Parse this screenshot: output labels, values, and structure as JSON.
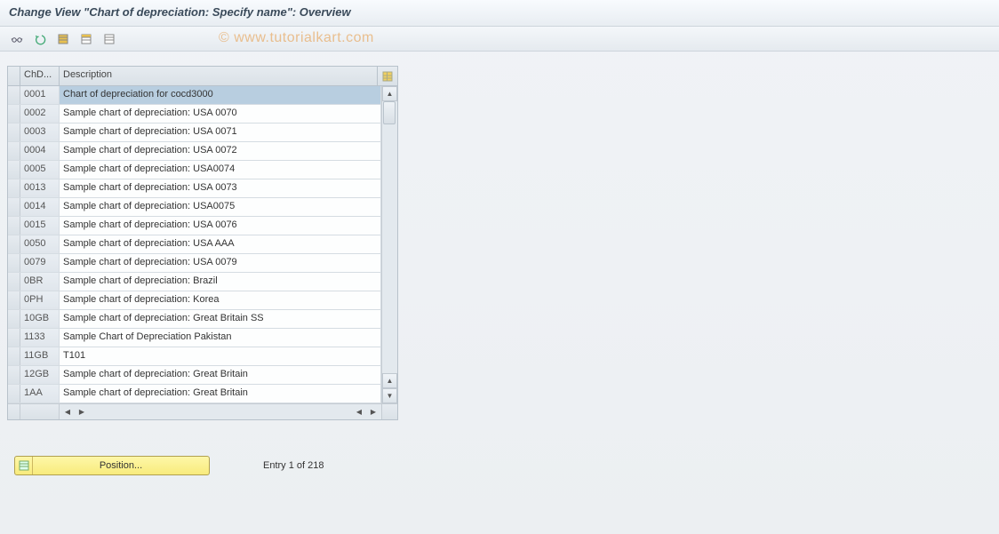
{
  "title": "Change View \"Chart of depreciation: Specify name\": Overview",
  "watermark": "© www.tutorialkart.com",
  "columns": {
    "chd": "ChD...",
    "desc": "Description"
  },
  "rows": [
    {
      "chd": "0001",
      "desc": "Chart of depreciation for cocd3000",
      "selected": true
    },
    {
      "chd": "0002",
      "desc": "Sample chart of depreciation: USA 0070"
    },
    {
      "chd": "0003",
      "desc": "Sample chart of depreciation: USA 0071"
    },
    {
      "chd": "0004",
      "desc": "Sample chart of depreciation: USA 0072"
    },
    {
      "chd": "0005",
      "desc": "Sample chart of depreciation: USA0074"
    },
    {
      "chd": "0013",
      "desc": "Sample chart of depreciation: USA 0073"
    },
    {
      "chd": "0014",
      "desc": "Sample chart of depreciation: USA0075"
    },
    {
      "chd": "0015",
      "desc": "Sample chart of depreciation: USA 0076"
    },
    {
      "chd": "0050",
      "desc": "Sample chart of depreciation: USA AAA"
    },
    {
      "chd": "0079",
      "desc": "Sample chart of depreciation: USA 0079"
    },
    {
      "chd": "0BR",
      "desc": "Sample chart of depreciation: Brazil"
    },
    {
      "chd": "0PH",
      "desc": "Sample chart of depreciation: Korea"
    },
    {
      "chd": "10GB",
      "desc": "Sample chart of depreciation: Great Britain SS"
    },
    {
      "chd": "1133",
      "desc": "Sample Chart of Depreciation Pakistan"
    },
    {
      "chd": "11GB",
      "desc": "T101"
    },
    {
      "chd": "12GB",
      "desc": "Sample chart of depreciation: Great Britain"
    },
    {
      "chd": "1AA",
      "desc": "Sample chart of depreciation: Great Britain"
    }
  ],
  "footer": {
    "position_button": "Position...",
    "entry_status": "Entry 1 of 218"
  }
}
